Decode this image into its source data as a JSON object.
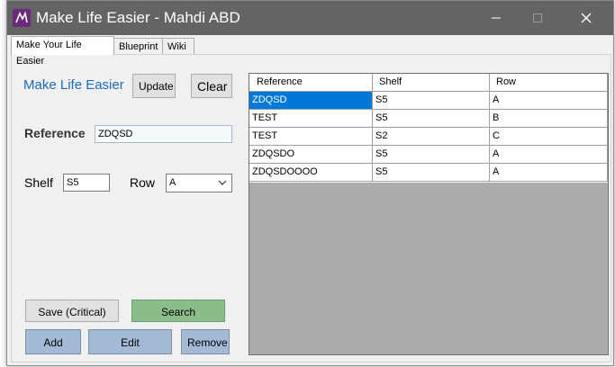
{
  "window": {
    "title": "Make Life Easier - Mahdi ABD",
    "minimize_glyph": "—",
    "maximize_glyph": "☐",
    "close_glyph": "✕"
  },
  "tabs": [
    {
      "label": "Make Your Life Easier",
      "active": true
    },
    {
      "label": "Blueprint",
      "active": false
    },
    {
      "label": "Wiki",
      "active": false
    }
  ],
  "form": {
    "heading": "Make Life Easier",
    "update_label": "Update",
    "clear_label": "Clear",
    "reference_label": "Reference",
    "reference_value": "ZDQSD",
    "shelf_label": "Shelf",
    "shelf_value": "S5",
    "row_label": "Row",
    "row_value": "A",
    "save_label": "Save (Critical)",
    "search_label": "Search",
    "add_label": "Add",
    "edit_label": "Edit",
    "remove_label": "Remove"
  },
  "table": {
    "columns": [
      "Reference",
      "Shelf",
      "Row"
    ],
    "rows": [
      {
        "reference": "ZDQSD",
        "shelf": "S5",
        "row": "A",
        "selected": true
      },
      {
        "reference": "TEST",
        "shelf": "S5",
        "row": "B",
        "selected": false
      },
      {
        "reference": "TEST",
        "shelf": "S2",
        "row": "C",
        "selected": false
      },
      {
        "reference": "ZDQSDO",
        "shelf": "S5",
        "row": "A",
        "selected": false
      },
      {
        "reference": "ZDQSDOOOO",
        "shelf": "S5",
        "row": "A",
        "selected": false
      }
    ]
  },
  "colors": {
    "titlebar": "#646464",
    "heading": "#1c6cbc",
    "selection": "#0078d7",
    "search_button": "#8bbd8b",
    "action_buttons": "#a3b9d5"
  },
  "icons": {
    "app": "app-logo-icon",
    "minimize": "minimize-icon",
    "maximize": "maximize-icon",
    "close": "close-icon",
    "dropdown": "chevron-down-icon"
  }
}
